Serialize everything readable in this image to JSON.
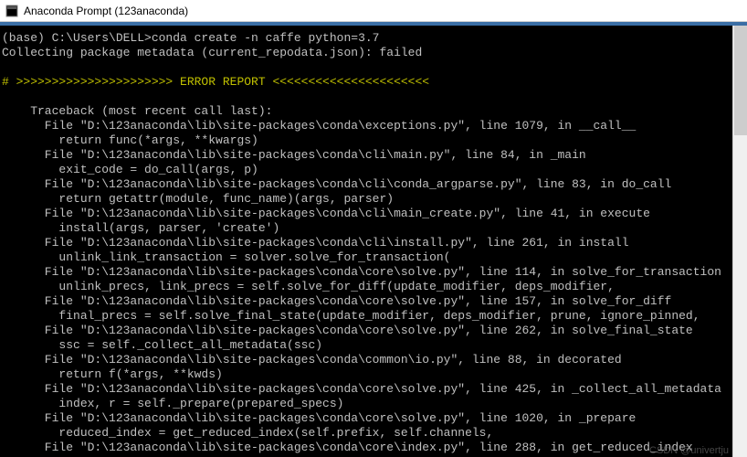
{
  "titlebar": {
    "title": "Anaconda Prompt (123anaconda)"
  },
  "term": {
    "prompt": "(base) C:\\Users\\DELL>conda create -n caffe python=3.7",
    "collecting": "Collecting package metadata (current_repodata.json): failed",
    "blank": "",
    "err_header": "# >>>>>>>>>>>>>>>>>>>>>> ERROR REPORT <<<<<<<<<<<<<<<<<<<<<<",
    "tb_head": "    Traceback (most recent call last):",
    "l01a": "      File \"D:\\123anaconda\\lib\\site-packages\\conda\\exceptions.py\", line 1079, in __call__",
    "l01b": "        return func(*args, **kwargs)",
    "l02a": "      File \"D:\\123anaconda\\lib\\site-packages\\conda\\cli\\main.py\", line 84, in _main",
    "l02b": "        exit_code = do_call(args, p)",
    "l03a": "      File \"D:\\123anaconda\\lib\\site-packages\\conda\\cli\\conda_argparse.py\", line 83, in do_call",
    "l03b": "        return getattr(module, func_name)(args, parser)",
    "l04a": "      File \"D:\\123anaconda\\lib\\site-packages\\conda\\cli\\main_create.py\", line 41, in execute",
    "l04b": "        install(args, parser, 'create')",
    "l05a": "      File \"D:\\123anaconda\\lib\\site-packages\\conda\\cli\\install.py\", line 261, in install",
    "l05b": "        unlink_link_transaction = solver.solve_for_transaction(",
    "l06a": "      File \"D:\\123anaconda\\lib\\site-packages\\conda\\core\\solve.py\", line 114, in solve_for_transaction",
    "l06b": "        unlink_precs, link_precs = self.solve_for_diff(update_modifier, deps_modifier,",
    "l07a": "      File \"D:\\123anaconda\\lib\\site-packages\\conda\\core\\solve.py\", line 157, in solve_for_diff",
    "l07b": "        final_precs = self.solve_final_state(update_modifier, deps_modifier, prune, ignore_pinned,",
    "l08a": "      File \"D:\\123anaconda\\lib\\site-packages\\conda\\core\\solve.py\", line 262, in solve_final_state",
    "l08b": "        ssc = self._collect_all_metadata(ssc)",
    "l09a": "      File \"D:\\123anaconda\\lib\\site-packages\\conda\\common\\io.py\", line 88, in decorated",
    "l09b": "        return f(*args, **kwds)",
    "l10a": "      File \"D:\\123anaconda\\lib\\site-packages\\conda\\core\\solve.py\", line 425, in _collect_all_metadata",
    "l10b": "        index, r = self._prepare(prepared_specs)",
    "l11a": "      File \"D:\\123anaconda\\lib\\site-packages\\conda\\core\\solve.py\", line 1020, in _prepare",
    "l11b": "        reduced_index = get_reduced_index(self.prefix, self.channels,",
    "l12a": "      File \"D:\\123anaconda\\lib\\site-packages\\conda\\core\\index.py\", line 288, in get_reduced_index"
  },
  "watermark": "CSDN @univertju"
}
